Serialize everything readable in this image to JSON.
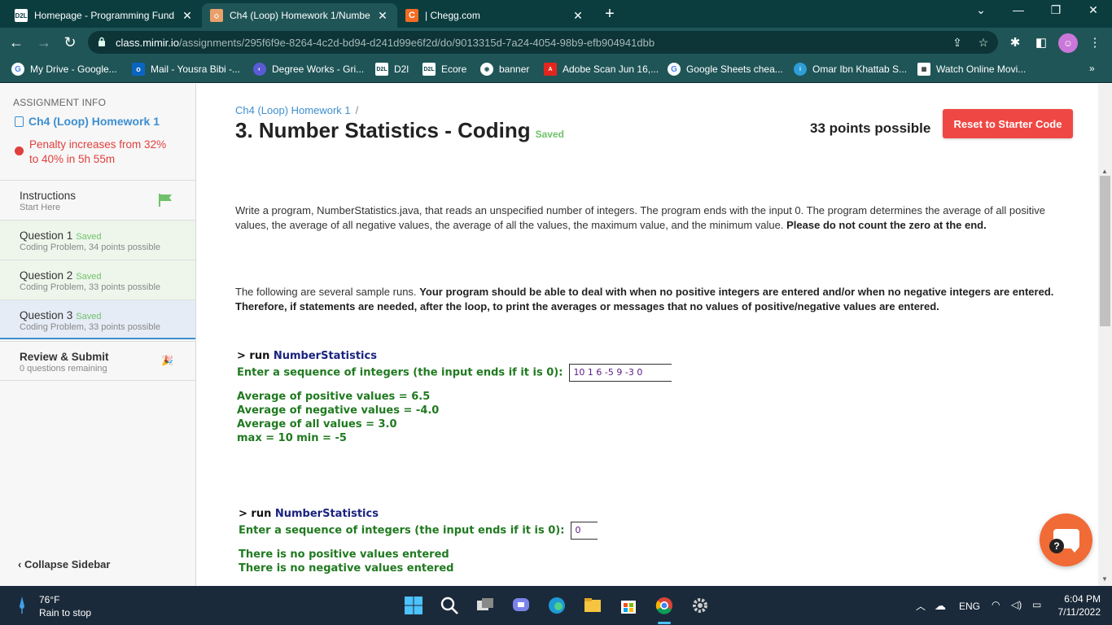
{
  "browser": {
    "tabs": [
      {
        "favicon": "D2L",
        "title": "Homepage - Programming Fund",
        "active": false
      },
      {
        "favicon": "mimir",
        "title": "Ch4 (Loop) Homework 1/Numbe",
        "active": true
      },
      {
        "favicon": "C",
        "title": "| Chegg.com",
        "active": false
      }
    ],
    "url_host": "class.mimir.io",
    "url_path": "/assignments/295f6f9e-8264-4c2d-bd94-d241d99e6f2d/do/9013315d-7a24-4054-98b9-efb904941dbb",
    "bookmarks": [
      "My Drive - Google...",
      "Mail - Yousra Bibi -...",
      "Degree Works - Gri...",
      "D2l",
      "Ecore",
      "banner",
      "Adobe Scan Jun 16,...",
      "Google Sheets chea...",
      "Omar Ibn Khattab S...",
      "Watch Online Movi..."
    ],
    "bookmark_more": "»"
  },
  "sidebar": {
    "label": "ASSIGNMENT INFO",
    "assignment": "Ch4 (Loop) Homework 1",
    "penalty": "Penalty increases from 32% to 40% in 5h 55m",
    "items": [
      {
        "title": "Instructions",
        "saved": "",
        "sub": "Start Here"
      },
      {
        "title": "Question 1",
        "saved": "Saved",
        "sub": "Coding Problem, 34 points possible"
      },
      {
        "title": "Question 2",
        "saved": "Saved",
        "sub": "Coding Problem, 33 points possible"
      },
      {
        "title": "Question 3",
        "saved": "Saved",
        "sub": "Coding Problem, 33 points possible"
      },
      {
        "title": "Review & Submit",
        "saved": "",
        "sub": "0 questions remaining"
      }
    ],
    "collapse": "Collapse Sidebar"
  },
  "main": {
    "breadcrumb": "Ch4 (Loop) Homework 1",
    "breadcrumb_sep": "/",
    "title": "3. Number Statistics - Coding",
    "saved": "Saved",
    "points": "33 points possible",
    "reset": "Reset to Starter Code",
    "para1": "Write a program, NumberStatistics.java, that reads an unspecified number of integers. The program ends with the input 0. The program determines the average of all positive values, the average of all negative values, the average of all the values, the maximum value, and the minimum value.",
    "para1_bold": "Please do not count the zero at the end.",
    "para2": "The following are several sample runs.",
    "para2_bold": "Your program should be able to deal with when no positive integers are entered and/or when no negative integers are entered. Therefore, if statements are needed, after the loop, to print the averages or messages that no values of positive/negative values are entered.",
    "run1": {
      "cmd_prefix": "> run",
      "cmd_name": "NumberStatistics",
      "prompt": "Enter a sequence of integers (the input ends if it is 0):",
      "input": "10  1  6  -5  9  -3   0",
      "out": [
        "Average of positive values = 6.5",
        "Average of negative values = -4.0",
        "Average of all values = 3.0",
        "max = 10 min = -5"
      ]
    },
    "run2": {
      "cmd_prefix": "> run",
      "cmd_name": "NumberStatistics",
      "prompt": "Enter a sequence of integers (the input ends if it is 0):",
      "input": "0",
      "out": [
        "There is no positive values entered",
        "There is no negative values entered"
      ]
    }
  },
  "taskbar": {
    "temp": "76°F",
    "condition": "Rain to stop",
    "lang": "ENG",
    "time": "6:04 PM",
    "date": "7/11/2022"
  }
}
